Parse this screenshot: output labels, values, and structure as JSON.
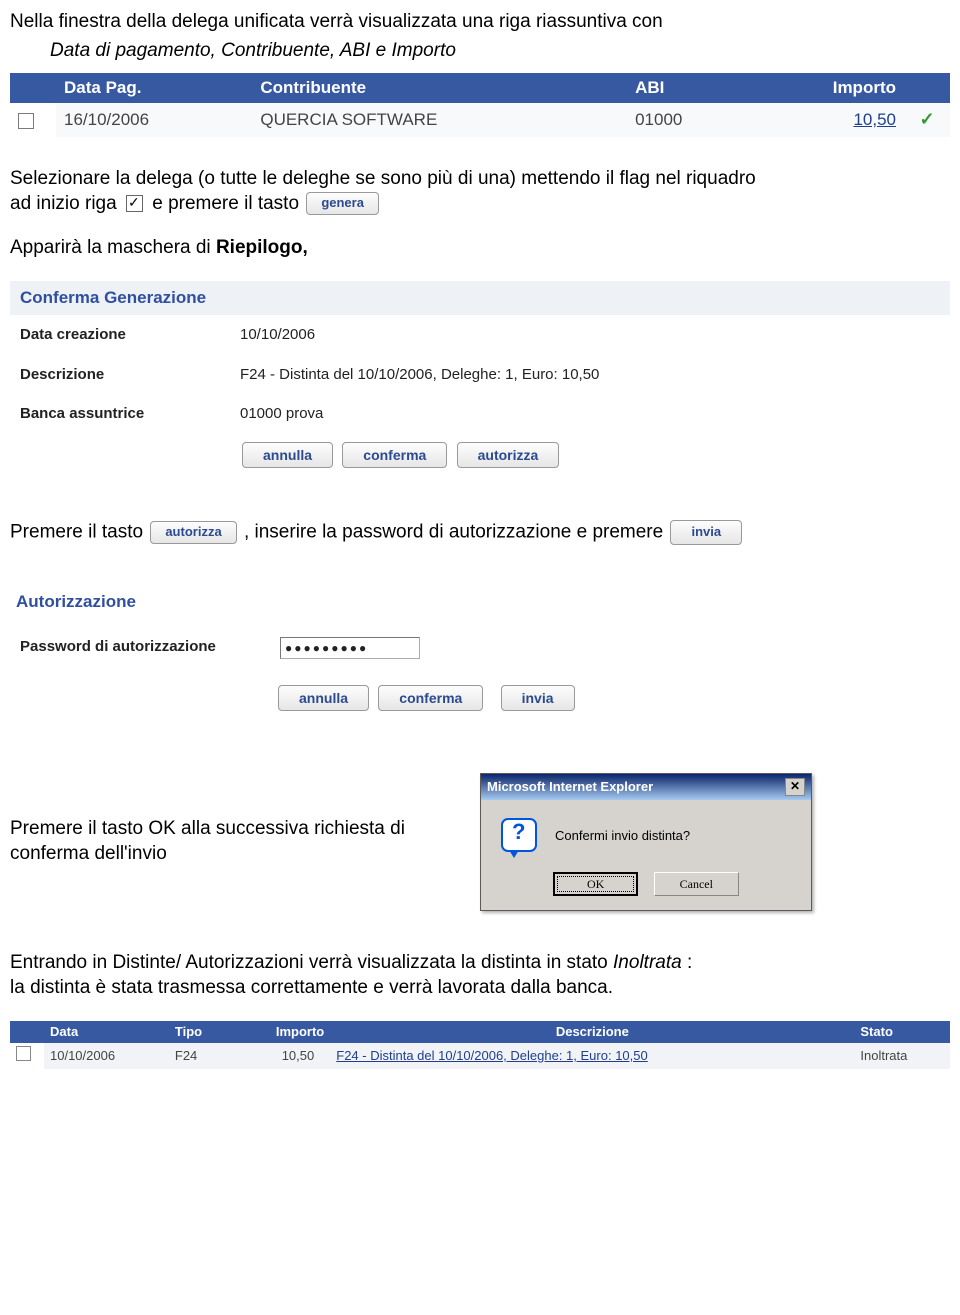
{
  "intro": {
    "line1": "Nella finestra della delega unificata verrà visualizzata una riga riassuntiva con",
    "line2": "Data di pagamento, Contribuente, ABI e Importo"
  },
  "table1": {
    "headers": {
      "data": "Data Pag.",
      "contribuente": "Contribuente",
      "abi": "ABI",
      "importo": "Importo"
    },
    "row": {
      "data": "16/10/2006",
      "contribuente": "QUERCIA SOFTWARE",
      "abi": "01000",
      "importo": "10,50"
    }
  },
  "para2": {
    "part1": "Selezionare la delega (o tutte le deleghe se sono più di una) mettendo il flag nel riquadro",
    "part2a": "ad inizio riga",
    "part2b": " e premere il tasto"
  },
  "btn_genera": "genera",
  "para3": {
    "pre": "Apparirà la maschera di ",
    "bold": "Riepilogo,",
    "post": ""
  },
  "conferma": {
    "title": "Conferma Generazione",
    "rows": {
      "data_label": "Data creazione",
      "data_value": "10/10/2006",
      "desc_label": "Descrizione",
      "desc_value": "F24 - Distinta del 10/10/2006, Deleghe: 1, Euro: 10,50",
      "banca_label": "Banca assuntrice",
      "banca_value": "01000 prova"
    },
    "buttons": {
      "annulla": "annulla",
      "conferma": "conferma",
      "autorizza": "autorizza"
    }
  },
  "para4": {
    "pre": "Premere il tasto ",
    "btn_autorizza": "autorizza",
    "mid": " , inserire la password di autorizzazione e premere ",
    "btn_invia": "invia"
  },
  "auth": {
    "title": "Autorizzazione",
    "pwd_label": "Password di autorizzazione",
    "pwd_value": "●●●●●●●●●",
    "buttons": {
      "annulla": "annulla",
      "conferma": "conferma",
      "invia": "invia"
    }
  },
  "dialog_para": "Premere il tasto  OK   alla successiva  richiesta di conferma dell'invio",
  "dialog": {
    "title": "Microsoft Internet Explorer",
    "message": "Confermi invio distinta?",
    "ok": "OK",
    "cancel": "Cancel"
  },
  "final": {
    "line1a": "Entrando in Distinte/ Autorizzazioni verrà visualizzata la distinta in stato ",
    "line1b": "Inoltrata",
    "line1c": " :",
    "line2": "la distinta è stata trasmessa correttamente e verrà lavorata dalla banca."
  },
  "table2": {
    "headers": {
      "data": "Data",
      "tipo": "Tipo",
      "importo": "Importo",
      "descrizione": "Descrizione",
      "stato": "Stato"
    },
    "row": {
      "data": "10/10/2006",
      "tipo": "F24",
      "importo": "10,50",
      "descrizione": "F24 - Distinta del 10/10/2006, Deleghe: 1, Euro: 10,50",
      "stato": "Inoltrata"
    }
  }
}
